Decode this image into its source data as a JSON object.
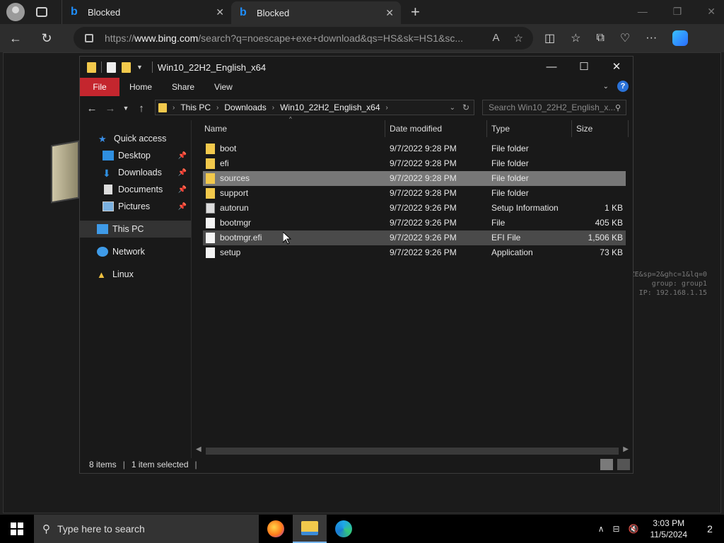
{
  "browser": {
    "tabs": [
      {
        "title": "Blocked"
      },
      {
        "title": "Blocked"
      }
    ],
    "url_prefix": "https://",
    "url_domain": "www.bing.com",
    "url_rest": "/search?q=noescape+exe+download&qs=HS&sk=HS1&sc..."
  },
  "explorer": {
    "title": "Win10_22H2_English_x64",
    "ribbon": {
      "file": "File",
      "home": "Home",
      "share": "Share",
      "view": "View"
    },
    "breadcrumb": [
      "This PC",
      "Downloads",
      "Win10_22H2_English_x64"
    ],
    "search_placeholder": "Search Win10_22H2_English_x...",
    "nav": {
      "quick_access": "Quick access",
      "desktop": "Desktop",
      "downloads": "Downloads",
      "documents": "Documents",
      "pictures": "Pictures",
      "this_pc": "This PC",
      "network": "Network",
      "linux": "Linux"
    },
    "columns": {
      "name": "Name",
      "date": "Date modified",
      "type": "Type",
      "size": "Size"
    },
    "files": [
      {
        "name": "boot",
        "date": "9/7/2022 9:28 PM",
        "type": "File folder",
        "size": "",
        "icon": "folder-icon"
      },
      {
        "name": "efi",
        "date": "9/7/2022 9:28 PM",
        "type": "File folder",
        "size": "",
        "icon": "folder-icon"
      },
      {
        "name": "sources",
        "date": "9/7/2022 9:28 PM",
        "type": "File folder",
        "size": "",
        "icon": "folder-icon"
      },
      {
        "name": "support",
        "date": "9/7/2022 9:28 PM",
        "type": "File folder",
        "size": "",
        "icon": "folder-icon"
      },
      {
        "name": "autorun",
        "date": "9/7/2022 9:26 PM",
        "type": "Setup Information",
        "size": "1 KB",
        "icon": "setup-info-icon"
      },
      {
        "name": "bootmgr",
        "date": "9/7/2022 9:26 PM",
        "type": "File",
        "size": "405 KB",
        "icon": "file-icon"
      },
      {
        "name": "bootmgr.efi",
        "date": "9/7/2022 9:26 PM",
        "type": "EFI File",
        "size": "1,506 KB",
        "icon": "file-icon"
      },
      {
        "name": "setup",
        "date": "9/7/2022 9:26 PM",
        "type": "Application",
        "size": "73 KB",
        "icon": "file-icon"
      }
    ],
    "status": {
      "items": "8 items",
      "selected": "1 item selected"
    }
  },
  "overlay_text": {
    "line1": "ZE&sp=2&ghc=1&lq=0",
    "line2": "group: group1",
    "line3": "IP: 192.168.1.15"
  },
  "taskbar": {
    "search_placeholder": "Type here to search",
    "time": "3:03 PM",
    "date": "11/5/2024",
    "notifications": "2"
  }
}
